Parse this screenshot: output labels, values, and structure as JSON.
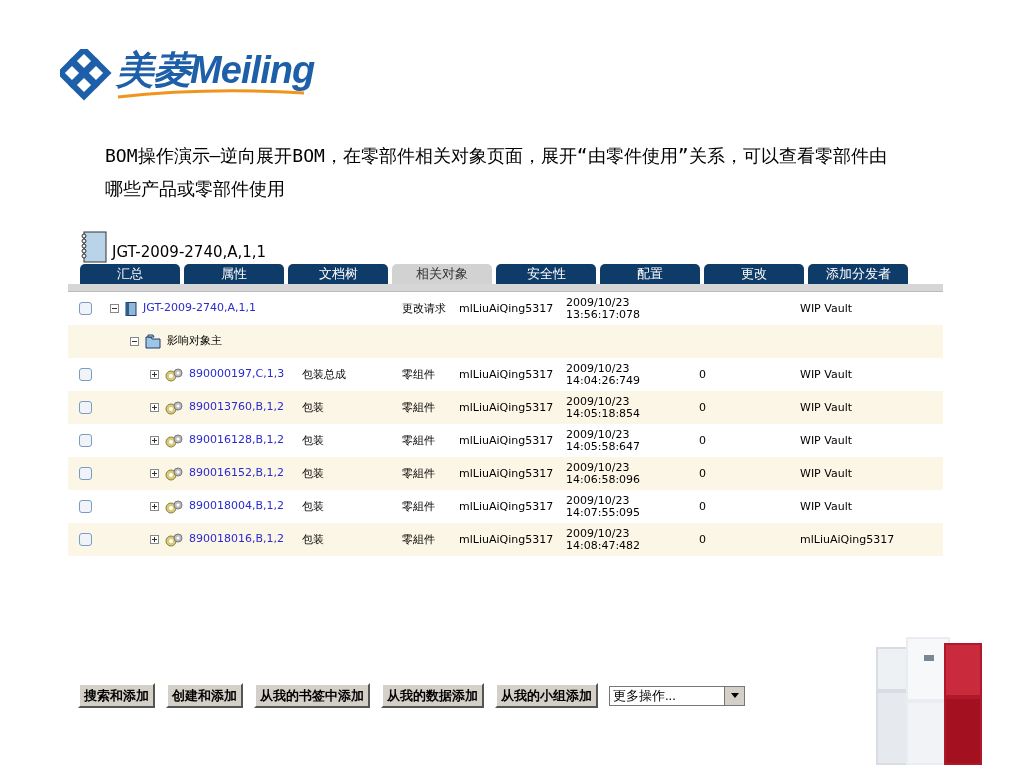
{
  "logo": {
    "text": "美菱Meiling"
  },
  "caption": "BOM操作演示—逆向展开BOM，在零部件相关对象页面，展开“由零件使用”关系，可以查看零部件由哪些产品或零部件使用",
  "screen": {
    "title": "JGT-2009-2740,A,1,1",
    "tabs": [
      {
        "label": "汇总",
        "selected": false
      },
      {
        "label": "属性",
        "selected": false
      },
      {
        "label": "文档树",
        "selected": false
      },
      {
        "label": "相关对象",
        "selected": true
      },
      {
        "label": "安全性",
        "selected": false
      },
      {
        "label": "配置",
        "selected": false
      },
      {
        "label": "更改",
        "selected": false
      },
      {
        "label": "添加分发者",
        "selected": false
      }
    ],
    "tree": [
      {
        "kind": "document",
        "name": "JGT-2009-2740,A,1,1",
        "expanded": true,
        "checked": false,
        "cells": [
          "",
          "更改请求",
          "mlLiuAiQing5317",
          "2009/10/23\n13:56:17:078",
          "",
          "WIP Vault"
        ],
        "children": [
          {
            "kind": "folder",
            "name": "影响对象主",
            "expanded": true,
            "cells": [
              "",
              "",
              "",
              "",
              "",
              ""
            ],
            "children": [
              {
                "kind": "part",
                "name": "890000197,C,1,3",
                "expanded": false,
                "checked": false,
                "cells": [
                  "包装总成",
                  "零组件",
                  "mlLiuAiQing5317",
                  "2009/10/23\n14:04:26:749",
                  "0",
                  "WIP Vault"
                ]
              },
              {
                "kind": "part",
                "name": "890013760,B,1,2",
                "expanded": false,
                "checked": false,
                "cells": [
                  "包装",
                  "零組件",
                  "mlLiuAiQing5317",
                  "2009/10/23\n14:05:18:854",
                  "0",
                  "WIP Vault"
                ]
              },
              {
                "kind": "part",
                "name": "890016128,B,1,2",
                "expanded": false,
                "checked": false,
                "cells": [
                  "包装",
                  "零組件",
                  "mlLiuAiQing5317",
                  "2009/10/23\n14:05:58:647",
                  "0",
                  "WIP Vault"
                ]
              },
              {
                "kind": "part",
                "name": "890016152,B,1,2",
                "expanded": false,
                "checked": false,
                "cells": [
                  "包装",
                  "零組件",
                  "mlLiuAiQing5317",
                  "2009/10/23\n14:06:58:096",
                  "0",
                  "WIP Vault"
                ]
              },
              {
                "kind": "part",
                "name": "890018004,B,1,2",
                "expanded": false,
                "checked": false,
                "cells": [
                  "包装",
                  "零組件",
                  "mlLiuAiQing5317",
                  "2009/10/23\n14:07:55:095",
                  "0",
                  "WIP Vault"
                ]
              },
              {
                "kind": "part",
                "name": "890018016,B,1,2",
                "expanded": false,
                "checked": false,
                "cells": [
                  "包装",
                  "零組件",
                  "mlLiuAiQing5317",
                  "2009/10/23\n14:08:47:482",
                  "0",
                  "mlLiuAiQing5317"
                ]
              }
            ]
          }
        ]
      }
    ],
    "buttons": [
      "搜索和添加",
      "创建和添加",
      "从我的书签中添加",
      "从我的数据添加",
      "从我的小组添加"
    ],
    "more_actions": {
      "value": "更多操作..."
    }
  }
}
